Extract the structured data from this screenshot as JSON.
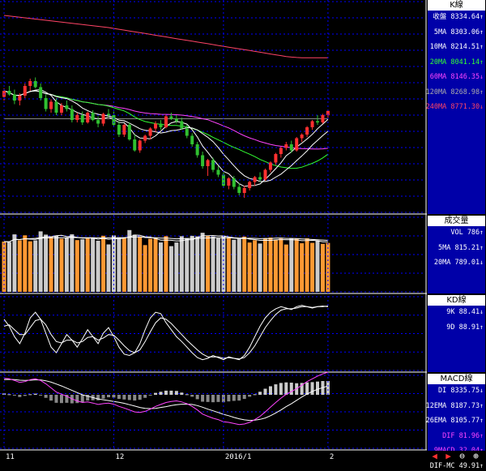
{
  "colors": {
    "up": "#ff3030",
    "down": "#30c030",
    "k_line": "#ffffff",
    "d_line": "#ffffff",
    "ma5": "#ffffff",
    "ma10": "#ffffff",
    "ma20": "#33ff33",
    "ma60": "#ff44ff",
    "ma120": "#888888",
    "ma240": "#ff4466",
    "vol_up": "#ff9933",
    "vol_down": "#cccccc",
    "macd_dif": "#ff44ff",
    "macd_ma": "#ffffff",
    "hist_pos": "#cccccc",
    "hist_neg": "#888888",
    "grid": "#0000ff",
    "panel_bg": "#0000a8"
  },
  "panels": {
    "k": {
      "title": "K線",
      "rows": [
        {
          "label": "收盤",
          "value": "8334.64",
          "arrow": "↑",
          "color": "#ffffff"
        },
        {
          "label": "5MA",
          "value": "8303.06",
          "arrow": "↑",
          "color": "#ffffff"
        },
        {
          "label": "10MA",
          "value": "8214.51",
          "arrow": "↑",
          "color": "#ffffff"
        },
        {
          "label": "20MA",
          "value": "8041.14",
          "arrow": "↑",
          "color": "#33ff33"
        },
        {
          "label": "60MA",
          "value": "8146.35",
          "arrow": "↓",
          "color": "#ff44ff"
        },
        {
          "label": "120MA",
          "value": "8268.98",
          "arrow": "↑",
          "color": "#aaaaaa"
        },
        {
          "label": "240MA",
          "value": "8771.30",
          "arrow": "↓",
          "color": "#ff4466"
        }
      ]
    },
    "vol": {
      "title": "成交量",
      "rows": [
        {
          "label": "VOL",
          "value": "786",
          "arrow": "↑",
          "color": "#ffffff"
        },
        {
          "label": "5MA",
          "value": "815.21",
          "arrow": "↑",
          "color": "#ffffff"
        },
        {
          "label": "20MA",
          "value": "789.01",
          "arrow": "↓",
          "color": "#ffffff"
        }
      ]
    },
    "kd": {
      "title": "KD線",
      "rows": [
        {
          "label": "9K",
          "value": "88.41",
          "arrow": "↓",
          "color": "#ffffff"
        },
        {
          "label": "9D",
          "value": "88.91",
          "arrow": "↑",
          "color": "#ffffff"
        }
      ]
    },
    "macd": {
      "title": "MACD線",
      "rows": [
        {
          "label": "DI",
          "value": "8335.75",
          "arrow": "↓",
          "color": "#ffffff"
        },
        {
          "label": "12EMA",
          "value": "8187.73",
          "arrow": "↑",
          "color": "#ffffff"
        },
        {
          "label": "26EMA",
          "value": "8105.77",
          "arrow": "↑",
          "color": "#ffffff"
        },
        {
          "label": "DIF",
          "value": "81.96",
          "arrow": "↑",
          "color": "#ff44ff"
        },
        {
          "label": "9MACD",
          "value": "32.04",
          "arrow": "↑",
          "color": "#ff44ff"
        },
        {
          "label": "DIF-MC",
          "value": "49.91",
          "arrow": "↑",
          "color": "#ffffff"
        }
      ]
    }
  },
  "toolbar": {
    "icons": [
      "arrow-left-icon",
      "arrow-right-icon",
      "zoom-out-icon",
      "zoom-in-icon"
    ]
  },
  "chart_data": {
    "type": "line",
    "x_ticks": [
      {
        "label": "11",
        "index": 0
      },
      {
        "label": "12",
        "index": 21
      },
      {
        "label": "2016/1",
        "index": 42
      },
      {
        "label": "2",
        "index": 62
      }
    ],
    "ohlc": [
      [
        8450,
        8520,
        8420,
        8500
      ],
      [
        8500,
        8540,
        8460,
        8470
      ],
      [
        8470,
        8510,
        8390,
        8420
      ],
      [
        8420,
        8480,
        8380,
        8460
      ],
      [
        8460,
        8560,
        8440,
        8540
      ],
      [
        8540,
        8600,
        8500,
        8580
      ],
      [
        8580,
        8610,
        8520,
        8530
      ],
      [
        8530,
        8560,
        8420,
        8440
      ],
      [
        8440,
        8470,
        8330,
        8350
      ],
      [
        8350,
        8430,
        8320,
        8410
      ],
      [
        8410,
        8440,
        8300,
        8320
      ],
      [
        8320,
        8400,
        8300,
        8380
      ],
      [
        8380,
        8420,
        8330,
        8350
      ],
      [
        8350,
        8380,
        8240,
        8260
      ],
      [
        8260,
        8320,
        8240,
        8300
      ],
      [
        8300,
        8330,
        8220,
        8240
      ],
      [
        8240,
        8330,
        8230,
        8320
      ],
      [
        8320,
        8340,
        8250,
        8260
      ],
      [
        8260,
        8290,
        8200,
        8230
      ],
      [
        8230,
        8320,
        8210,
        8310
      ],
      [
        8310,
        8350,
        8280,
        8300
      ],
      [
        8300,
        8330,
        8210,
        8220
      ],
      [
        8220,
        8250,
        8120,
        8140
      ],
      [
        8140,
        8230,
        8120,
        8220
      ],
      [
        8220,
        8240,
        8090,
        8100
      ],
      [
        8100,
        8140,
        8000,
        8010
      ],
      [
        8010,
        8100,
        7990,
        8090
      ],
      [
        8090,
        8140,
        8070,
        8130
      ],
      [
        8130,
        8200,
        8100,
        8190
      ],
      [
        8190,
        8250,
        8160,
        8230
      ],
      [
        8230,
        8260,
        8180,
        8200
      ],
      [
        8200,
        8300,
        8190,
        8290
      ],
      [
        8290,
        8320,
        8260,
        8270
      ],
      [
        8270,
        8300,
        8230,
        8250
      ],
      [
        8250,
        8280,
        8180,
        8190
      ],
      [
        8190,
        8220,
        8110,
        8130
      ],
      [
        8130,
        8150,
        8040,
        8060
      ],
      [
        8060,
        8080,
        7950,
        7970
      ],
      [
        7970,
        8000,
        7860,
        7880
      ],
      [
        7880,
        7940,
        7800,
        7930
      ],
      [
        7930,
        7950,
        7830,
        7850
      ],
      [
        7850,
        7880,
        7790,
        7810
      ],
      [
        7810,
        7830,
        7700,
        7720
      ],
      [
        7720,
        7790,
        7690,
        7780
      ],
      [
        7780,
        7800,
        7690,
        7710
      ],
      [
        7710,
        7740,
        7640,
        7660
      ],
      [
        7660,
        7720,
        7620,
        7700
      ],
      [
        7700,
        7760,
        7680,
        7750
      ],
      [
        7750,
        7800,
        7720,
        7790
      ],
      [
        7790,
        7830,
        7750,
        7770
      ],
      [
        7770,
        7860,
        7760,
        7850
      ],
      [
        7850,
        7920,
        7830,
        7910
      ],
      [
        7910,
        7990,
        7890,
        7980
      ],
      [
        7980,
        8040,
        7950,
        8030
      ],
      [
        8030,
        8080,
        8010,
        8060
      ],
      [
        8060,
        8090,
        7990,
        8010
      ],
      [
        8010,
        8120,
        8000,
        8110
      ],
      [
        8110,
        8150,
        8080,
        8140
      ],
      [
        8140,
        8210,
        8120,
        8200
      ],
      [
        8200,
        8260,
        8180,
        8250
      ],
      [
        8250,
        8300,
        8220,
        8240
      ],
      [
        8240,
        8310,
        8230,
        8300
      ],
      [
        8300,
        8340,
        8270,
        8335
      ]
    ],
    "ma120": [
      8270,
      8270,
      8270,
      8270,
      8270,
      8270,
      8270,
      8270,
      8270,
      8270,
      8270,
      8270,
      8270,
      8270,
      8270,
      8270,
      8270,
      8270,
      8270,
      8270,
      8270,
      8270,
      8270,
      8270,
      8270,
      8270,
      8270,
      8270,
      8270,
      8270,
      8270,
      8270,
      8270,
      8270,
      8270,
      8270,
      8270,
      8270,
      8270,
      8270,
      8270,
      8270,
      8270,
      8270,
      8270,
      8270,
      8270,
      8270,
      8270,
      8270,
      8270,
      8270,
      8270,
      8270,
      8270,
      8270,
      8270,
      8270,
      8270,
      8270,
      8270,
      8270,
      8269
    ],
    "ma240": [
      9120,
      9115,
      9110,
      9105,
      9100,
      9095,
      9090,
      9085,
      9080,
      9075,
      9070,
      9065,
      9060,
      9055,
      9050,
      9045,
      9040,
      9035,
      9030,
      9025,
      9020,
      9013,
      9006,
      8999,
      8992,
      8985,
      8978,
      8971,
      8964,
      8957,
      8950,
      8943,
      8936,
      8929,
      8922,
      8915,
      8908,
      8901,
      8894,
      8887,
      8880,
      8873,
      8866,
      8859,
      8852,
      8845,
      8838,
      8831,
      8824,
      8817,
      8810,
      8803,
      8796,
      8789,
      8782,
      8777,
      8774,
      8772,
      8771,
      8771,
      8771,
      8771,
      8771
    ],
    "kd_k": [
      70,
      60,
      45,
      35,
      50,
      72,
      80,
      70,
      50,
      30,
      22,
      35,
      48,
      40,
      30,
      42,
      55,
      45,
      35,
      50,
      58,
      45,
      30,
      20,
      18,
      22,
      35,
      55,
      72,
      80,
      78,
      65,
      55,
      45,
      38,
      30,
      22,
      15,
      12,
      14,
      18,
      15,
      12,
      16,
      14,
      12,
      18,
      30,
      45,
      60,
      72,
      80,
      85,
      88,
      86,
      84,
      88,
      90,
      88,
      86,
      88,
      89,
      88
    ],
    "kd_d": [
      60,
      62,
      55,
      48,
      48,
      58,
      68,
      70,
      62,
      48,
      38,
      36,
      40,
      40,
      36,
      38,
      44,
      45,
      40,
      43,
      48,
      47,
      40,
      32,
      25,
      22,
      26,
      38,
      52,
      65,
      72,
      70,
      64,
      56,
      48,
      40,
      33,
      26,
      20,
      16,
      16,
      16,
      14,
      15,
      14,
      13,
      15,
      22,
      32,
      45,
      58,
      68,
      77,
      83,
      85,
      85,
      86,
      88,
      88,
      87,
      88,
      88,
      89
    ],
    "dif": [
      60,
      58,
      52,
      45,
      48,
      55,
      58,
      52,
      40,
      25,
      10,
      2,
      -5,
      -15,
      -22,
      -28,
      -26,
      -30,
      -35,
      -32,
      -30,
      -34,
      -42,
      -48,
      -55,
      -62,
      -64,
      -60,
      -52,
      -42,
      -35,
      -28,
      -24,
      -22,
      -26,
      -32,
      -42,
      -55,
      -70,
      -78,
      -85,
      -90,
      -98,
      -100,
      -104,
      -108,
      -106,
      -100,
      -90,
      -78,
      -62,
      -45,
      -28,
      -12,
      2,
      12,
      22,
      35,
      48,
      58,
      68,
      76,
      82
    ],
    "macd_signal": [
      55,
      56,
      55,
      53,
      52,
      53,
      54,
      54,
      51,
      46,
      39,
      32,
      24,
      16,
      8,
      0,
      -5,
      -10,
      -15,
      -18,
      -21,
      -24,
      -27,
      -31,
      -36,
      -41,
      -46,
      -49,
      -50,
      -49,
      -46,
      -43,
      -39,
      -36,
      -34,
      -34,
      -35,
      -39,
      -45,
      -52,
      -58,
      -64,
      -71,
      -76,
      -82,
      -87,
      -91,
      -93,
      -92,
      -89,
      -84,
      -76,
      -66,
      -55,
      -43,
      -32,
      -20,
      -8,
      3,
      12,
      20,
      26,
      32
    ]
  }
}
